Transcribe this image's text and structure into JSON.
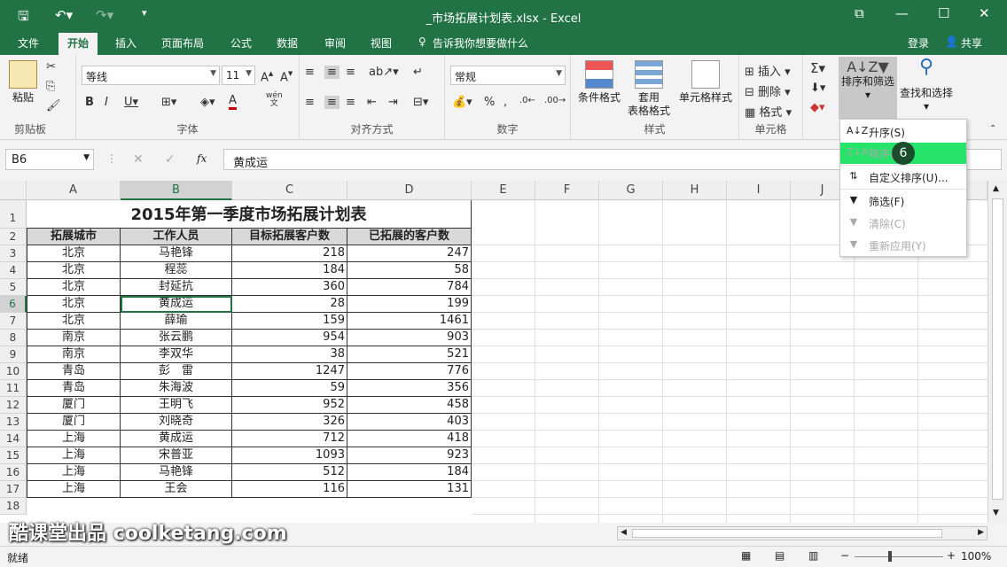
{
  "window": {
    "title": "_市场拓展计划表.xlsx - Excel"
  },
  "tabs": [
    "文件",
    "开始",
    "插入",
    "页面布局",
    "公式",
    "数据",
    "审阅",
    "视图"
  ],
  "tell_me": "告诉我你想要做什么",
  "login": "登录",
  "share": "共享",
  "ribbon": {
    "clipboard": {
      "paste": "粘贴",
      "label": "剪贴板"
    },
    "font": {
      "name": "等线",
      "size": "11",
      "label": "字体",
      "wen": "wén",
      "wen_char": "文"
    },
    "align": {
      "label": "对齐方式"
    },
    "number": {
      "format": "常规",
      "label": "数字",
      "pct": "%",
      "comma": ","
    },
    "styles": {
      "cond": "条件格式",
      "table1": "套用",
      "table2": "表格格式",
      "cell": "单元格样式",
      "label": "样式"
    },
    "cells": {
      "insert": "插入",
      "delete": "删除",
      "format": "格式",
      "label": "单元格"
    },
    "editing": {
      "sort": "排序和筛选",
      "find": "查找和选择"
    }
  },
  "formula_bar": {
    "name_box": "B6",
    "content": "黄成运",
    "fx": "fx"
  },
  "columns": [
    "A",
    "B",
    "C",
    "D",
    "E",
    "F",
    "G",
    "H",
    "I",
    "J"
  ],
  "rows": [
    "1",
    "2",
    "3",
    "4",
    "5",
    "6",
    "7",
    "8",
    "9",
    "10",
    "11",
    "12",
    "13",
    "14",
    "15",
    "16",
    "17",
    "18"
  ],
  "sheet": {
    "title": "2015年第一季度市场拓展计划表",
    "headers": [
      "拓展城市",
      "工作人员",
      "目标拓展客户数",
      "已拓展的客户数"
    ],
    "data": [
      [
        "北京",
        "马艳锋",
        "218",
        "247"
      ],
      [
        "北京",
        "程蕊",
        "184",
        "58"
      ],
      [
        "北京",
        "封延抗",
        "360",
        "784"
      ],
      [
        "北京",
        "黄成运",
        "28",
        "199"
      ],
      [
        "北京",
        "薛瑜",
        "159",
        "1461"
      ],
      [
        "南京",
        "张云鹏",
        "954",
        "903"
      ],
      [
        "南京",
        "李双华",
        "38",
        "521"
      ],
      [
        "青岛",
        "彭　雷",
        "1247",
        "776"
      ],
      [
        "青岛",
        "朱海波",
        "59",
        "356"
      ],
      [
        "厦门",
        "王明飞",
        "952",
        "458"
      ],
      [
        "厦门",
        "刘晓奇",
        "326",
        "403"
      ],
      [
        "上海",
        "黄成运",
        "712",
        "418"
      ],
      [
        "上海",
        "宋普亚",
        "1093",
        "923"
      ],
      [
        "上海",
        "马艳锋",
        "512",
        "184"
      ],
      [
        "上海",
        "王会",
        "116",
        "131"
      ]
    ]
  },
  "menu": {
    "items": [
      {
        "label": "升序(S)",
        "icon": "A↓Z",
        "disabled": false
      },
      {
        "label": "降序(O)",
        "icon": "Z↓A",
        "disabled": true
      },
      {
        "label": "自定义排序(U)...",
        "icon": "⇅",
        "disabled": false
      },
      {
        "label": "筛选(F)",
        "icon": "▼",
        "disabled": false
      },
      {
        "label": "清除(C)",
        "icon": "▼",
        "disabled": true
      },
      {
        "label": "重新应用(Y)",
        "icon": "▼",
        "disabled": true
      }
    ]
  },
  "badge": "6",
  "status": {
    "ready": "就绪",
    "zoom": "100%"
  },
  "watermark": "酷课堂出品 coolketang.com",
  "colors": {
    "excel_green": "#217346",
    "highlight": "#26e36a"
  }
}
